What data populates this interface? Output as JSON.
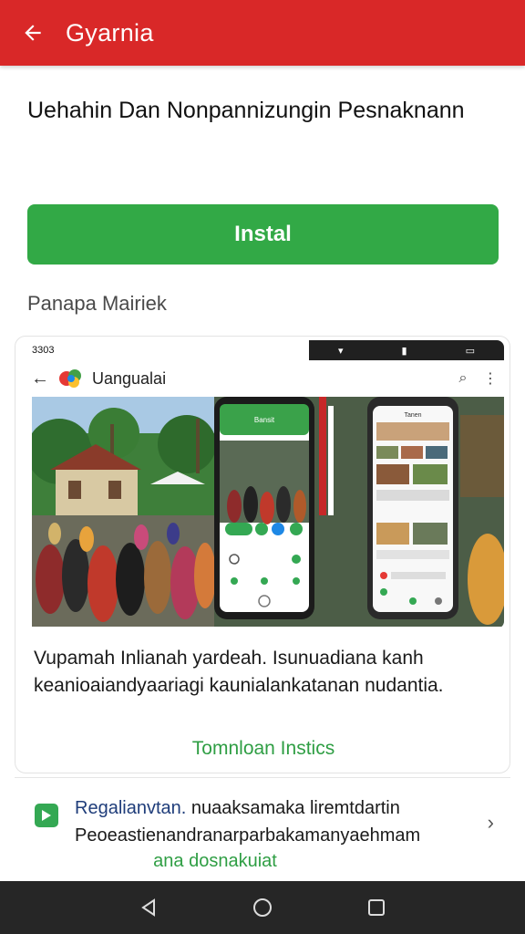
{
  "appbar": {
    "title": "Gyarnia",
    "back_icon": "arrow-left-icon",
    "color": "#d92828"
  },
  "page": {
    "title": "Uehahin Dan Nonpannizungin Pesnaknann",
    "install_label": "Instal",
    "install_color": "#32a946",
    "section_label": "Panapa Mairiek"
  },
  "screenshot": {
    "status_time": "3303",
    "app_name": "Uangualai",
    "phone1_header": "Bansit",
    "phone2_header": "Tanen"
  },
  "card": {
    "description": "Vupamah Inlianah yardeah. Isunuadiana kanh keanioaiandyaariagi kaunialankatanan nudantia.",
    "link_label": "Tomnloan Instics"
  },
  "promo": {
    "line1_highlight": "Regalianvtan.",
    "line1_rest": " nuaaksamaka liremtdartin",
    "line2": "Peoeastienandranarparbakamanyaehmam",
    "line3": "ana dosnakuiat"
  },
  "navbar": {
    "icons": [
      "back-triangle-icon",
      "home-circle-icon",
      "recents-square-icon"
    ]
  }
}
